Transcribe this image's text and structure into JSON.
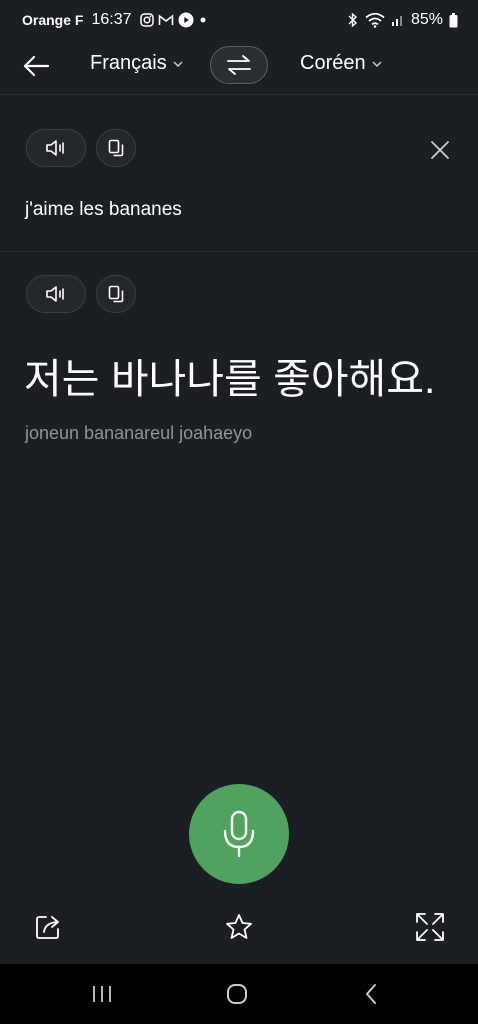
{
  "status_bar": {
    "carrier": "Orange F",
    "time": "16:37",
    "notification_icons": [
      "instagram-icon",
      "gmail-icon",
      "youtube-icon",
      "dot-icon"
    ],
    "right_icons": [
      "bluetooth-icon",
      "wifi-icon",
      "signal-icon"
    ],
    "battery": "85%"
  },
  "header": {
    "source_language": "Français",
    "target_language": "Coréen"
  },
  "source": {
    "text": "j'aime les bananes"
  },
  "target": {
    "text": "저는 바나나를 좋아해요.",
    "romanization": "joneun bananareul joahaeyo"
  },
  "colors": {
    "background": "#1b1e22",
    "mic_button": "#4fa35e",
    "romanization_text": "#8e949b"
  }
}
